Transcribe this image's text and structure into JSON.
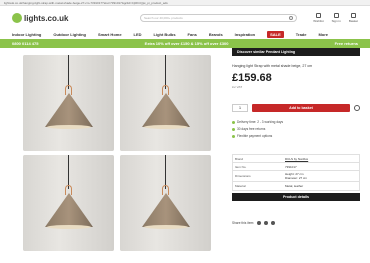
{
  "browser": {
    "url": "lightsuk.co.uk/hanging-light-strap-with-metal-shade-beige-27-cm-7391017?sku=7391017&gclid=Cj0KCQjw_pi_product_ads"
  },
  "header": {
    "logo_text": "lights.co.uk",
    "search_placeholder": "Search our 40,000+ products",
    "icons": [
      {
        "name": "wishlist-icon",
        "label": "Wishlist"
      },
      {
        "name": "account-icon",
        "label": "Sign in"
      },
      {
        "name": "basket-icon",
        "label": "Basket"
      }
    ]
  },
  "nav": {
    "items": [
      "Indoor Lighting",
      "Outdoor Lighting",
      "Smart Home",
      "LED",
      "Light Bulbs",
      "Fans",
      "Brands",
      "Inspiration"
    ],
    "sale": "SALE",
    "extra": [
      "Trade",
      "More"
    ]
  },
  "promo": {
    "phone": "0800 0114 475",
    "offer": "Extra 10% off over £150 & 15% off over £300",
    "secure": "Free returns"
  },
  "product": {
    "discover": "Discover similar Pendant Lighting",
    "title": "Hanging light Strap with metal shade beige, 27 cm",
    "price": "£159.68",
    "vat": "inc VAT",
    "qty": "1",
    "add_to_basket": "Add to basket",
    "checks": [
      "Delivery time: 2 - 3 working days",
      "30 days free returns",
      "Flexible payment options"
    ],
    "specs": [
      {
        "k": "Brand",
        "v": "DCLS by Nordlux",
        "link": true
      },
      {
        "k": "Item No.",
        "v": "7391017",
        "link": false
      },
      {
        "k": "Dimensions",
        "v": "Height: 27 cm\nDiameter: 27 cm",
        "link": false
      },
      {
        "k": "Material",
        "v": "Metal, leather",
        "link": false
      }
    ],
    "product_details": "Product details",
    "share_label": "Share this item:"
  },
  "colors": {
    "brand": "#8bc34a",
    "cta": "#c62828"
  }
}
